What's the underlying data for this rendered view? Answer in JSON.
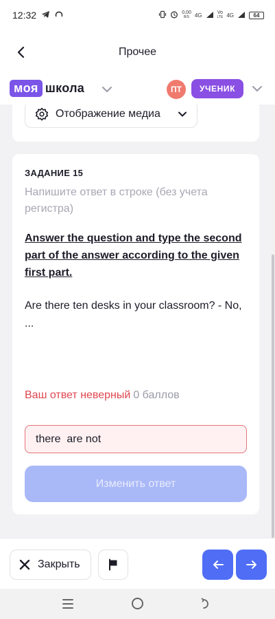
{
  "status_bar": {
    "time": "12:32",
    "net_speed_value": "0,00",
    "net_speed_unit": "B/S",
    "signal1": "4G",
    "volte_top": "Vo",
    "volte_bottom": "LTE",
    "signal2": "4G",
    "battery": "64"
  },
  "header": {
    "title": "Прочее"
  },
  "brand": {
    "logo_box": "моя",
    "logo_text": "школа",
    "avatar_initials": "ПТ",
    "role": "УЧЕНИК"
  },
  "media": {
    "label": "Отображение медиа"
  },
  "task": {
    "number": "ЗАДАНИЕ 15",
    "hint": "Напишите ответ в строке (без учета регистра)",
    "instruction": "Answer the question and type the second part of the answer according to the given first part.",
    "question": "Are there ten desks in your classroom? - No, ...",
    "result_wrong": "Ваш ответ неверный",
    "result_points": "0 баллов",
    "answer": "there  are not",
    "change_button": "Изменить ответ"
  },
  "bottom": {
    "close_label": "Закрыть"
  },
  "colors": {
    "accent": "#4f6df5",
    "brand_purple": "#7b55e8",
    "error": "#e0464f",
    "disabled_button": "#a9b8f7"
  },
  "icons": {
    "back": "chevron-left-icon",
    "media": "gear-icon",
    "close": "close-icon",
    "flag": "flag-icon",
    "prev": "arrow-left-icon",
    "next": "arrow-right-icon"
  }
}
